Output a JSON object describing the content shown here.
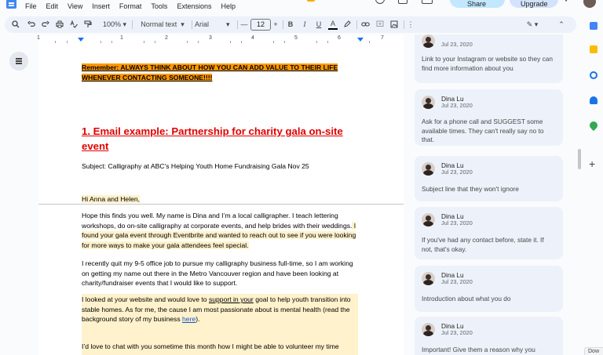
{
  "menu": [
    "File",
    "Edit",
    "View",
    "Insert",
    "Format",
    "Tools",
    "Extensions",
    "Help"
  ],
  "top_right": {
    "share": "Share",
    "upgrade": "Upgrade"
  },
  "toolbar": {
    "zoom": "100%",
    "zoom_arrow": "▾",
    "style": "Normal text",
    "style_arrow": "▾",
    "font": "Arial",
    "font_arrow": "▾",
    "minus": "—",
    "font_size": "12",
    "plus": "+",
    "bold": "B",
    "italic": "I",
    "underline": "U",
    "text_color": "A",
    "more": "⋮",
    "edit_mode": "✎ ▾",
    "collapse": "⌃"
  },
  "ruler": [
    "1",
    "1",
    "2",
    "3",
    "4",
    "5",
    "6",
    "7"
  ],
  "document": {
    "remember": "Remember: ALWAYS THINK ABOUT HOW YOU CAN ADD VALUE TO THEIR LIFE WHENEVER CONTACTING SOMEONE!!!!",
    "heading": "1. Email example: Partnership for charity gala on-site event",
    "subject": "Subject: Calligraphy at ABC's Helping Youth Home Fundraising Gala Nov 25",
    "greeting": "Hi Anna and Helen,",
    "para1_a": "Hope this finds you well. My name is Dina and I’m a local calligrapher. I teach lettering workshops, do on-site calligraphy at corporate events, and help brides with their weddings.",
    "para1_b": " I found your gala event through Eventbrite and wanted to reach out to see if you were looking for more ways to make your gala attendees feel special.",
    "para2": "I recently quit my 9-5 office job to pursue my calligraphy business full-time, so I am working on getting my name out there in the Metro Vancouver region and have been looking at charity/fundraiser events that I would like to support.",
    "para3_a": "I looked at your website and would love to ",
    "para3_link": "support in your",
    "para3_b": " goal to help youth transition into stable homes. As for me, the cause I am most passionate about is mental health (read the background story of my business ",
    "para3_here": "here",
    "para3_c": ").",
    "para4": "I’d love to chat with you sometime this month how I might be able to volunteer my time"
  },
  "comments": [
    {
      "name": "",
      "date": "Jul 23, 2020",
      "text": "Link to your Instagram or website so they can find more information about you"
    },
    {
      "name": "Dina Lu",
      "date": "Jul 23, 2020",
      "text": "Ask for a phone call and SUGGEST some available times. They can't really say no to that."
    },
    {
      "name": "Dina Lu",
      "date": "Jul 23, 2020",
      "text": "Subject line that they won't ignore"
    },
    {
      "name": "Dina Lu",
      "date": "Jul 23, 2020",
      "text": "If you've had any contact before, state it. If not, that's okay."
    },
    {
      "name": "Dina Lu",
      "date": "Jul 23, 2020",
      "text": "Introduction about what you do"
    },
    {
      "name": "Dina Lu",
      "date": "Jul 23, 2020",
      "text": "Important! Give them a reason why you"
    }
  ],
  "download_label": "Dow",
  "colors": {
    "accent": "#1a73e8",
    "heading_red": "#e00000",
    "highlight_orange": "#ff9900",
    "highlight_yellow": "#fff2cc"
  }
}
